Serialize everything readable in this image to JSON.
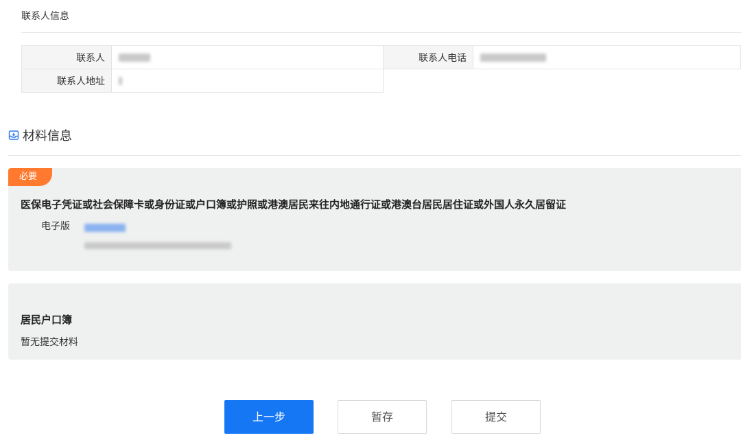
{
  "contact_section": {
    "title": "联系人信息",
    "contact_label": "联系人",
    "phone_label": "联系人电话",
    "address_label": "联系人地址"
  },
  "materials": {
    "title": "材料信息",
    "items": [
      {
        "badge": "必要",
        "name": "医保电子凭证或社会保障卡或身份证或户口簿或护照或港澳居民来往内地通行证或港澳台居民居住证或外国人永久居留证",
        "type_label": "电子版"
      },
      {
        "name": "居民户口簿",
        "empty_text": "暂无提交材料"
      }
    ]
  },
  "buttons": {
    "prev": "上一步",
    "save": "暂存",
    "submit": "提交"
  },
  "colors": {
    "primary": "#1677f5",
    "badge": "#ff7a2e",
    "card_bg": "#eff0f0"
  }
}
